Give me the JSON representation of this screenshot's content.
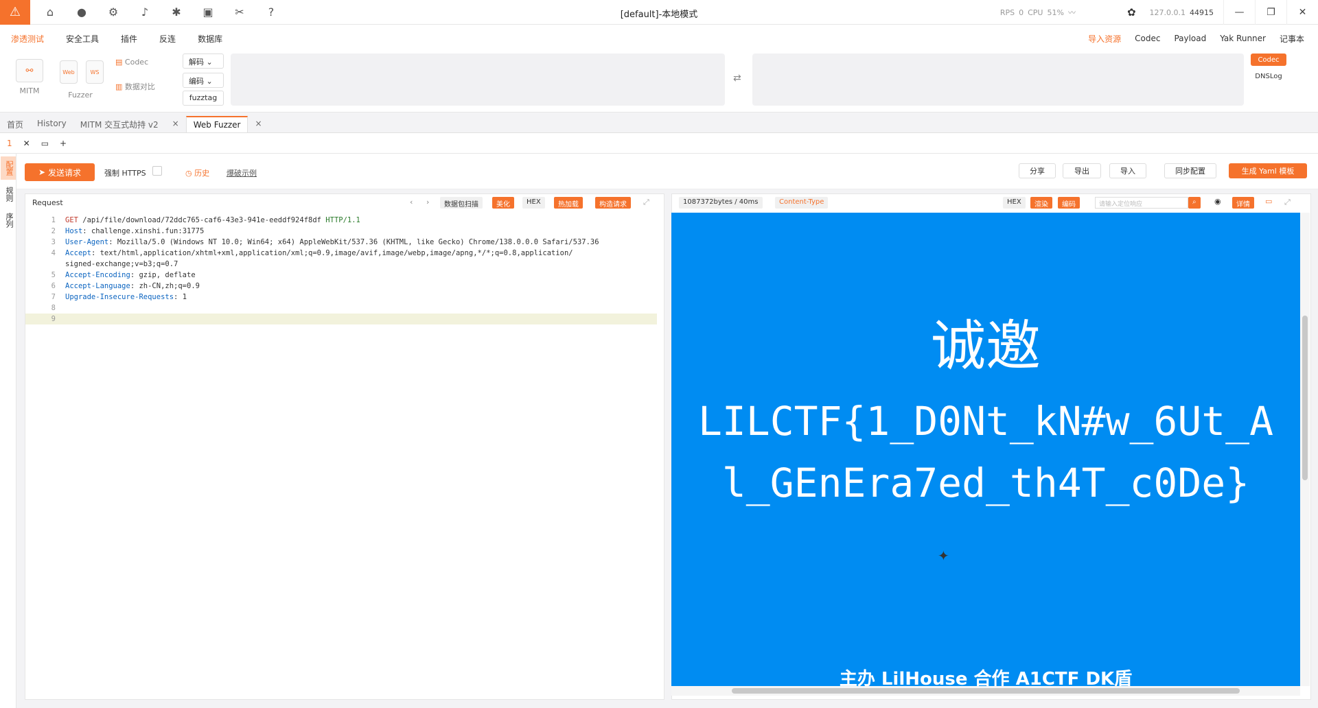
{
  "title": "[default]-本地模式",
  "status": {
    "rps_label": "RPS",
    "rps": "0",
    "cpu_label": "CPU",
    "cpu": "51%",
    "address": "127.0.0.1",
    "port": "44915"
  },
  "menu": [
    "渗透测试",
    "安全工具",
    "插件",
    "反连",
    "数据库"
  ],
  "menu_right": [
    "导入资源",
    "Codec",
    "Payload",
    "Yak Runner",
    "记事本"
  ],
  "tools": {
    "mitm": "MITM",
    "fuzzer": "Fuzzer",
    "web": "Web",
    "ws": "WS",
    "codec": "Codec",
    "compare": "数据对比"
  },
  "selects": {
    "decode": "解码",
    "encode": "编码",
    "fuzztag": "fuzztag"
  },
  "side_buttons": {
    "codec": "Codec",
    "dnslog": "DNSLog"
  },
  "tabs": [
    "首页",
    "History",
    "MITM 交互式劫持 v2",
    "Web Fuzzer"
  ],
  "subtab": {
    "index": "1"
  },
  "side_tabs": [
    "配置",
    "规则",
    "序列"
  ],
  "actions": {
    "send": "发送请求",
    "https": "强制 HTTPS",
    "history": "历史",
    "example": "爆破示例",
    "share": "分享",
    "export": "导出",
    "import": "导入",
    "sync": "同步配置",
    "yaml": "生成 Yaml 模板"
  },
  "request": {
    "label": "Request",
    "buttons": {
      "scan": "数据包扫描",
      "beautify": "美化",
      "hex": "HEX",
      "hotload": "热加载",
      "construct": "构造请求"
    },
    "lines": [
      {
        "n": "1",
        "method": "GET",
        "path": " /api/file/download/72ddc765-caf6-43e3-941e-eeddf924f8df ",
        "proto": "HTTP/1.1"
      },
      {
        "n": "2",
        "key": "Host",
        "val": ": challenge.xinshi.fun:31775"
      },
      {
        "n": "3",
        "key": "User-Agent",
        "val": ": Mozilla/5.0 (Windows NT 10.0; Win64; x64) AppleWebKit/537.36 (KHTML, like Gecko) Chrome/138.0.0.0 Safari/537.36"
      },
      {
        "n": "4",
        "key": "Accept",
        "val": ": text/html,application/xhtml+xml,application/xml;q=0.9,image/avif,image/webp,image/apng,*/*;q=0.8,application/"
      },
      {
        "n": "",
        "key": "",
        "val": "signed-exchange;v=b3;q=0.7"
      },
      {
        "n": "5",
        "key": "Accept-Encoding",
        "val": ": gzip, deflate"
      },
      {
        "n": "6",
        "key": "Accept-Language",
        "val": ": zh-CN,zh;q=0.9"
      },
      {
        "n": "7",
        "key": "Upgrade-Insecure-Requests",
        "val": ": 1"
      },
      {
        "n": "8",
        "key": "",
        "val": ""
      },
      {
        "n": "9",
        "key": "",
        "val": ""
      }
    ]
  },
  "response": {
    "size": "1087372bytes / 40ms",
    "content_type": "Content-Type",
    "buttons": {
      "hex": "HEX",
      "render": "渲染",
      "encode": "编码",
      "detail": "详情"
    },
    "search_placeholder": "请输入定位响应",
    "invite": "诚邀",
    "flag_line1": "LILCTF{1_D0Nt_kN#w_6Ut_A",
    "flag_line2": "l_GEnEra7ed_th4T_c0De}",
    "footer": "主办  LilHouse    合作  A1CTF  DK盾"
  },
  "colors": {
    "accent": "#f5722c",
    "response_bg": "#008cf2"
  }
}
